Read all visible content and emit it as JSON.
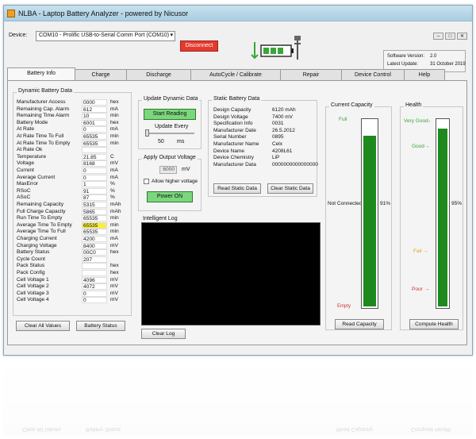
{
  "window": {
    "title": "NLBA - Laptop Battery Analyzer - powered by Nicusor"
  },
  "device": {
    "label": "Device:",
    "port": "COM10 - Prolific USB-to-Serial Comm Port (COM10)",
    "disconnect_label": "Disconnect"
  },
  "version": {
    "software_label": "Software Version:",
    "software_value": "2.0",
    "update_label": "Latest Update:",
    "update_value": "31 October 2019"
  },
  "tabs": [
    {
      "label": "Battery Info"
    },
    {
      "label": "Charge"
    },
    {
      "label": "Discharge"
    },
    {
      "label": "AutoCycle / Calibrate"
    },
    {
      "label": "Repair"
    },
    {
      "label": "Device Control"
    },
    {
      "label": "Help"
    }
  ],
  "dynamic": {
    "title": "Dynamic Battery Data",
    "rows": [
      {
        "name": "Manufacturer Access",
        "value": "0000",
        "unit": "hex"
      },
      {
        "name": "Remaining Cap. Alarm",
        "value": "612",
        "unit": "mA"
      },
      {
        "name": "Remaining Time Alarm",
        "value": "10",
        "unit": "min"
      },
      {
        "name": "Battery Mode",
        "value": "6001",
        "unit": "hex"
      },
      {
        "name": "At Rate",
        "value": "0",
        "unit": "mA"
      },
      {
        "name": "At Rate Time To Full",
        "value": "65535",
        "unit": "min"
      },
      {
        "name": "At Rate Time To Empty",
        "value": "65535",
        "unit": "min"
      },
      {
        "name": "At Rate Ok",
        "value": "",
        "unit": ""
      },
      {
        "name": "Temperature",
        "value": "21.85",
        "unit": "C"
      },
      {
        "name": "Voltage",
        "value": "8168",
        "unit": "mV"
      },
      {
        "name": "Current",
        "value": "0",
        "unit": "mA"
      },
      {
        "name": "Average Current",
        "value": "0",
        "unit": "mA"
      },
      {
        "name": "MaxError",
        "value": "1",
        "unit": "%"
      },
      {
        "name": "RSoC",
        "value": "91",
        "unit": "%"
      },
      {
        "name": "ASoC",
        "value": "87",
        "unit": "%"
      },
      {
        "name": "Remaining Capacity",
        "value": "5315",
        "unit": "mAh"
      },
      {
        "name": "Full Charge Capacity",
        "value": "5865",
        "unit": "mAh"
      },
      {
        "name": "Run Time To Empty",
        "value": "65535",
        "unit": "min"
      },
      {
        "name": "Average Time To Empty",
        "value": "65535",
        "unit": "min",
        "highlight": true
      },
      {
        "name": "Average Time To Full",
        "value": "65535",
        "unit": "min"
      },
      {
        "name": "Charging Current",
        "value": "4200",
        "unit": "mA"
      },
      {
        "name": "Charging Voltage",
        "value": "8400",
        "unit": "mV"
      },
      {
        "name": "Battery Status",
        "value": "00C0",
        "unit": "hex"
      },
      {
        "name": "Cycle Count",
        "value": "207",
        "unit": ""
      },
      {
        "name": "Pack Status",
        "value": "",
        "unit": "hex"
      },
      {
        "name": "Pack Config",
        "value": "",
        "unit": "hex"
      },
      {
        "name": "Cell Voltage 1",
        "value": "4096",
        "unit": "mV"
      },
      {
        "name": "Cell Voltage 2",
        "value": "4072",
        "unit": "mV"
      },
      {
        "name": "Cell Voltage 3",
        "value": "0",
        "unit": "mV"
      },
      {
        "name": "Cell Voltage 4",
        "value": "0",
        "unit": "mV"
      }
    ],
    "clear_label": "Clear All Values",
    "status_label": "Battery Status"
  },
  "update": {
    "title": "Update Dynamic Data",
    "start_label": "Start Reading",
    "every_label": "Update Every",
    "value": "50",
    "unit": "ms"
  },
  "output": {
    "title": "Apply Output Voltage",
    "value": "6000",
    "unit": "mV",
    "allow_label": "Allow higher voltage",
    "power_label": "Power ON"
  },
  "static": {
    "title": "Static Battery Data",
    "rows": [
      {
        "name": "Design Capacity",
        "value": "6120 mAh"
      },
      {
        "name": "Design Voltage",
        "value": "7400 mV"
      },
      {
        "name": "Specification Info",
        "value": "0031"
      },
      {
        "name": "Manufacturer Date",
        "value": "26.5.2012"
      },
      {
        "name": "Serial Number",
        "value": "0895"
      },
      {
        "name": "Manufacturer Name",
        "value": "Celx"
      },
      {
        "name": "Device Name",
        "value": "4208L61"
      },
      {
        "name": "Device Chemistry",
        "value": "LiP"
      },
      {
        "name": "Manufacturer Data",
        "value": "0000000000000000"
      }
    ],
    "read_label": "Read Static Data",
    "clear_label": "Clear Static Data"
  },
  "log": {
    "title": "Intelligent Log",
    "clear_label": "Clear Log"
  },
  "capacity": {
    "title": "Current Capacity",
    "full": "Full",
    "empty": "Empty",
    "not_connected": "Not Connected",
    "percent": "91%",
    "level": 0.91,
    "read_label": "Read Capacity"
  },
  "health": {
    "title": "Health",
    "very_good": "Very Good",
    "good": "Good",
    "fair": "Fair",
    "poor": "Poor",
    "percent": "95%",
    "level": 0.95,
    "compute_label": "Compute Health"
  },
  "colors": {
    "gauge": "#1e8a1e",
    "highlight": "#f7ef3b",
    "disconnect": "#e43a2e",
    "green_button": "#7bd77b",
    "very_good": "#3aa63a",
    "good": "#3aa63a",
    "fair": "#e0a020",
    "poor": "#d03030"
  }
}
